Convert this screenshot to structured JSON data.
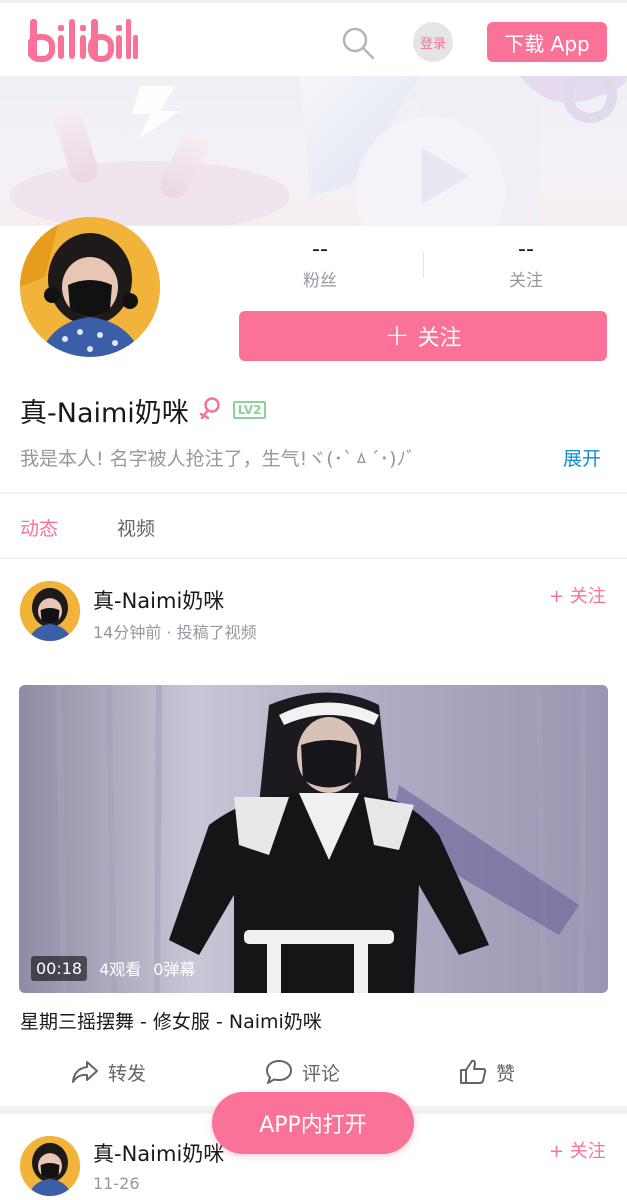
{
  "header": {
    "logo_alt": "bilibili",
    "login_label": "登录",
    "download_label": "下载 App"
  },
  "profile": {
    "stats": [
      {
        "value": "--",
        "label": "粉丝"
      },
      {
        "value": "--",
        "label": "关注"
      }
    ],
    "follow_label": "关注",
    "name": "真-Naimi奶咪",
    "level": "LV2",
    "bio": "我是本人! 名字被人抢注了，生气!ヾ(･`ㅿ´･)ﾉﾞ",
    "expand_label": "展开"
  },
  "tabs": [
    {
      "label": "动态",
      "active": true
    },
    {
      "label": "视频",
      "active": false
    }
  ],
  "feed": [
    {
      "author": "真-Naimi奶咪",
      "meta": "14分钟前 · 投稿了视频",
      "follow_label": "+ 关注",
      "video": {
        "duration": "00:18",
        "views": "4观看",
        "danmaku": "0弹幕",
        "title": "星期三摇摆舞 - 修女服 - Naimi奶咪"
      },
      "actions": {
        "share": "转发",
        "comment": "评论",
        "like": "赞"
      }
    },
    {
      "author": "真-Naimi奶咪",
      "meta": "11-26",
      "follow_label": "+ 关注"
    }
  ],
  "open_app_label": "APP内打开",
  "colors": {
    "brand_pink": "#fb7299",
    "link_blue": "#178bcf",
    "level_green": "#8bd29b"
  }
}
